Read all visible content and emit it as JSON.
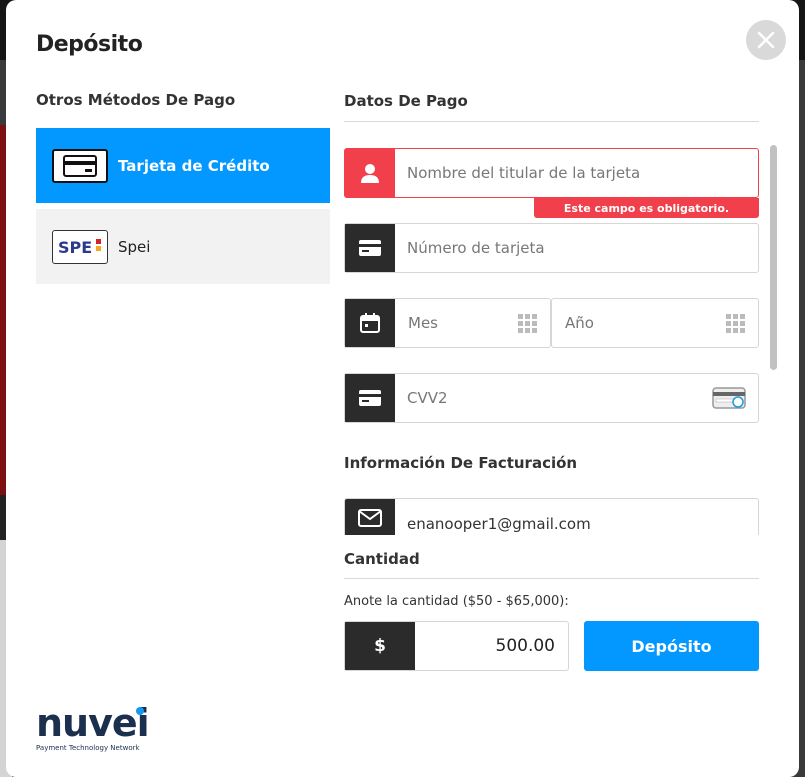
{
  "modal": {
    "title": "Depósito"
  },
  "methods": {
    "title": "Otros Métodos De Pago",
    "items": [
      {
        "label": "Tarjeta de Crédito",
        "icon": "credit-card-icon",
        "active": true
      },
      {
        "label": "Spei",
        "icon": "spei-logo",
        "logo_text": "SPEI",
        "active": false
      }
    ]
  },
  "payment": {
    "title": "Datos De Pago",
    "cardholder": {
      "placeholder": "Nombre del titular de la tarjeta",
      "icon": "user-icon",
      "error": "Este campo es obligatorio."
    },
    "card_number": {
      "placeholder": "Número de tarjeta",
      "icon": "card-icon"
    },
    "month": {
      "placeholder": "Mes",
      "icon": "calendar-icon"
    },
    "year": {
      "placeholder": "Año"
    },
    "cvv": {
      "placeholder": "CVV2",
      "icon": "card-icon"
    }
  },
  "billing": {
    "title": "Información De Facturación",
    "email": {
      "value": "enanooper1@gmail.com",
      "icon": "mail-icon"
    }
  },
  "amount": {
    "title": "Cantidad",
    "label": "Anote la cantidad ($50 - $65,000):",
    "currency": "$",
    "value": "500.00",
    "button": "Depósito"
  },
  "brand": {
    "name": "nuvei",
    "tagline": "Payment Technology Network"
  },
  "colors": {
    "accent": "#0298ff",
    "error": "#f1404b",
    "dark": "#2b2b2b",
    "brand": "#1b2f4e"
  }
}
